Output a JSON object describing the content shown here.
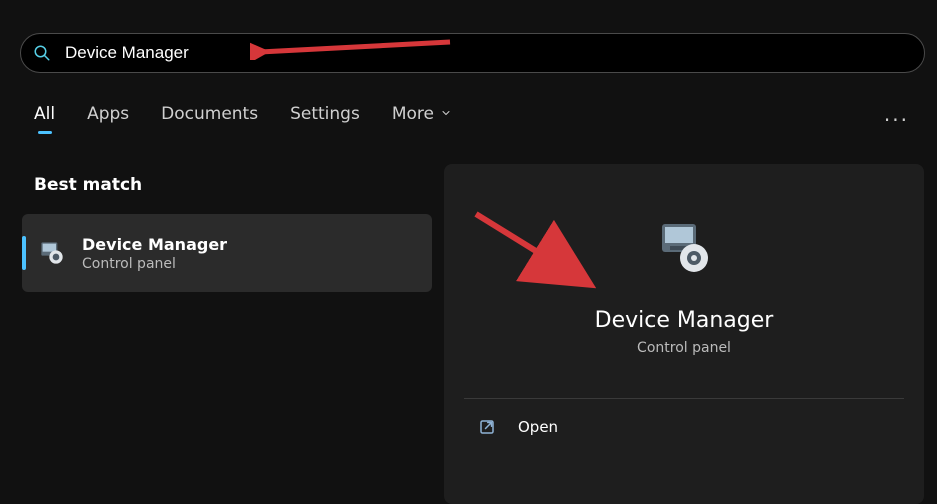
{
  "search": {
    "query": "Device Manager"
  },
  "tabs": {
    "all": "All",
    "apps": "Apps",
    "documents": "Documents",
    "settings": "Settings",
    "more": "More"
  },
  "overflow_label": "···",
  "best_match_heading": "Best match",
  "result": {
    "title": "Device Manager",
    "subtitle": "Control panel"
  },
  "detail": {
    "title": "Device Manager",
    "subtitle": "Control panel",
    "actions": {
      "open": "Open"
    }
  },
  "icons": {
    "search": "search-icon",
    "chevron_down": "chevron-down-icon",
    "device_mgr": "device-manager-icon",
    "open_ext": "open-external-icon"
  }
}
